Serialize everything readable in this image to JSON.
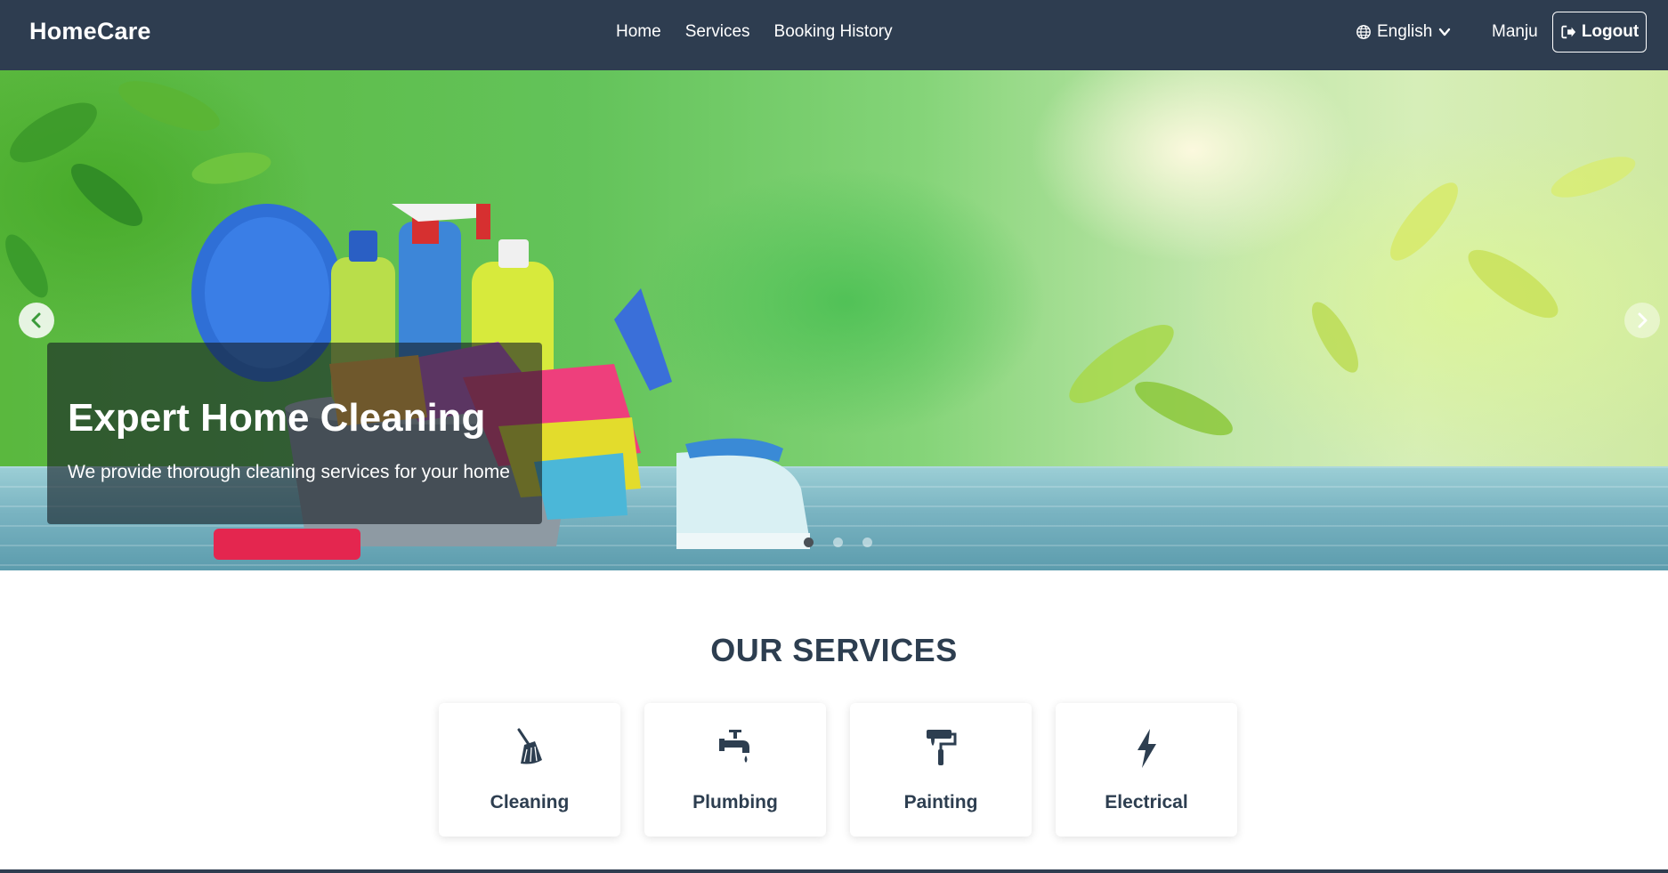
{
  "navbar": {
    "brand": "HomeCare",
    "links": [
      "Home",
      "Services",
      "Booking History"
    ],
    "language": "English",
    "user": "Manju",
    "logout_label": "Logout"
  },
  "hero": {
    "title": "Expert Home Cleaning",
    "subtitle": "We provide thorough cleaning services for your home",
    "slides_total": 3,
    "active_slide": 1
  },
  "services": {
    "heading": "OUR SERVICES",
    "items": [
      {
        "label": "Cleaning",
        "icon": "broom-icon"
      },
      {
        "label": "Plumbing",
        "icon": "faucet-icon"
      },
      {
        "label": "Painting",
        "icon": "paint-roller-icon"
      },
      {
        "label": "Electrical",
        "icon": "lightning-bolt-icon"
      }
    ]
  },
  "colors": {
    "navbar_bg": "#2e3d50",
    "heading_text": "#2d3e50",
    "caption_bg": "rgba(20,28,35,0.6)"
  }
}
